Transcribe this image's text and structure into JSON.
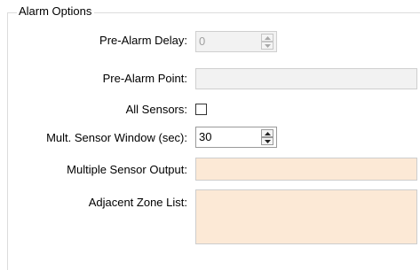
{
  "group": {
    "title": "Alarm Options"
  },
  "fields": {
    "pre_alarm_delay": {
      "label": "Pre-Alarm Delay:",
      "value": "0",
      "enabled": false
    },
    "pre_alarm_point": {
      "label": "Pre-Alarm Point:",
      "value": ""
    },
    "all_sensors": {
      "label": "All Sensors:",
      "checked": false
    },
    "mult_sensor_window": {
      "label": "Mult. Sensor Window (sec):",
      "value": "30"
    },
    "multiple_sensor_output": {
      "label": "Multiple Sensor Output:",
      "value": "",
      "background": "#fce9d6"
    },
    "adjacent_zone_list": {
      "label": "Adjacent Zone List:",
      "value": "",
      "background": "#fce9d6"
    }
  }
}
